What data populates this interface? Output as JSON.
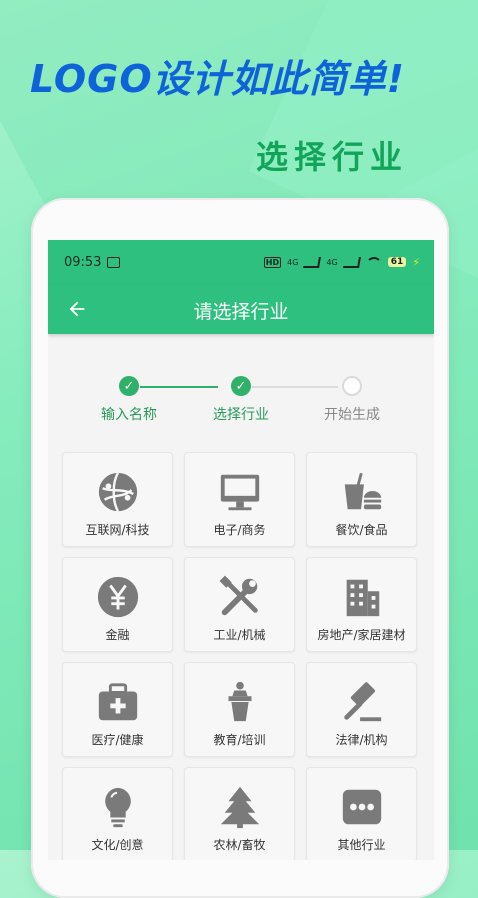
{
  "promo": {
    "headline": "LOGO设计如此简单!",
    "subhead": "选择行业"
  },
  "status": {
    "time": "09:53",
    "network1": "4G",
    "network2": "4G",
    "battery": "61"
  },
  "appbar": {
    "title": "请选择行业"
  },
  "steps": [
    {
      "label": "输入名称",
      "state": "done"
    },
    {
      "label": "选择行业",
      "state": "done"
    },
    {
      "label": "开始生成",
      "state": "todo"
    }
  ],
  "industries": [
    {
      "label": "互联网/科技",
      "icon": "globe-icon"
    },
    {
      "label": "电子/商务",
      "icon": "monitor-icon"
    },
    {
      "label": "餐饮/食品",
      "icon": "food-icon"
    },
    {
      "label": "金融",
      "icon": "yen-coin-icon"
    },
    {
      "label": "工业/机械",
      "icon": "tools-icon"
    },
    {
      "label": "房地产/家居建材",
      "icon": "building-icon"
    },
    {
      "label": "医疗/健康",
      "icon": "medical-kit-icon"
    },
    {
      "label": "教育/培训",
      "icon": "lectern-icon"
    },
    {
      "label": "法律/机构",
      "icon": "gavel-icon"
    },
    {
      "label": "文化/创意",
      "icon": "lightbulb-icon"
    },
    {
      "label": "农林/畜牧",
      "icon": "tree-icon"
    },
    {
      "label": "其他行业",
      "icon": "more-icon"
    }
  ],
  "colors": {
    "primary": "#2ec07f",
    "step_active": "#2fb16a",
    "headline": "#0f63d9",
    "subhead": "#12a55a",
    "icon": "#7a7a7a"
  }
}
